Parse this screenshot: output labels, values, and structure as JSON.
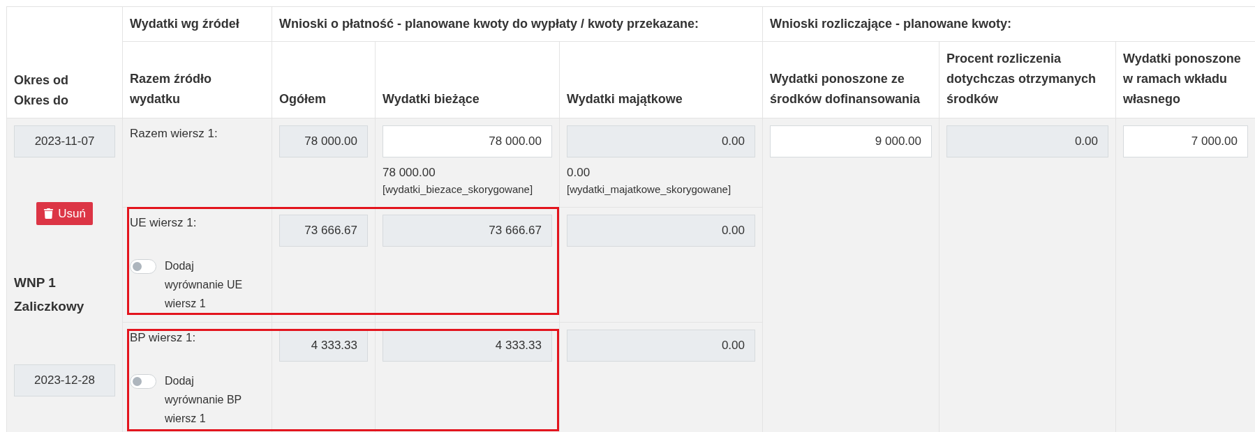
{
  "period_header": [
    "Okres od",
    "Okres do"
  ],
  "group_headers": [
    "Wydatki wg źródeł",
    "Wnioski o płatność - planowane kwoty do wypłaty / kwoty przekazane:",
    "Wnioski rozliczające - planowane kwoty:"
  ],
  "columns": [
    "Razem źródło wydatku",
    "Ogółem",
    "Wydatki bieżące",
    "Wydatki majątkowe",
    "Wydatki ponoszone ze środków dofinansowania",
    "Procent rozliczenia dotychczas otrzymanych środków",
    "Wydatki ponoszone w ramach wkładu własnego"
  ],
  "period": {
    "date_from": "2023-11-07",
    "delete_button": "Usuń",
    "name": "WNP 1 Zaliczkowy",
    "date_to": "2023-12-28"
  },
  "rows": [
    {
      "label": "Razem wiersz 1:",
      "highlighted": false,
      "cells": [
        {
          "value": "78 000.00",
          "editable": false
        },
        {
          "value": "78 000.00",
          "editable": true,
          "note": "78 000.00",
          "field": "[wydatki_biezace_skorygowane]"
        },
        {
          "value": "0.00",
          "editable": false,
          "note": "0.00",
          "field": "[wydatki_majatkowe_skorygowane]"
        }
      ]
    },
    {
      "label": "UE wiersz 1:",
      "highlighted": true,
      "toggle": {
        "label": "Dodaj wyrównanie UE wiersz 1",
        "on": false
      },
      "cells": [
        {
          "value": "73 666.67",
          "editable": false
        },
        {
          "value": "73 666.67",
          "editable": false
        },
        {
          "value": "0.00",
          "editable": false
        }
      ]
    },
    {
      "label": "BP wiersz 1:",
      "highlighted": true,
      "toggle": {
        "label": "Dodaj wyrównanie BP wiersz 1",
        "on": false
      },
      "cells": [
        {
          "value": "4 333.33",
          "editable": false
        },
        {
          "value": "4 333.33",
          "editable": false
        },
        {
          "value": "0.00",
          "editable": false
        }
      ]
    }
  ],
  "settlement": [
    {
      "value": "9 000.00",
      "editable": true
    },
    {
      "value": "0.00",
      "editable": false
    },
    {
      "value": "7 000.00",
      "editable": true
    }
  ]
}
